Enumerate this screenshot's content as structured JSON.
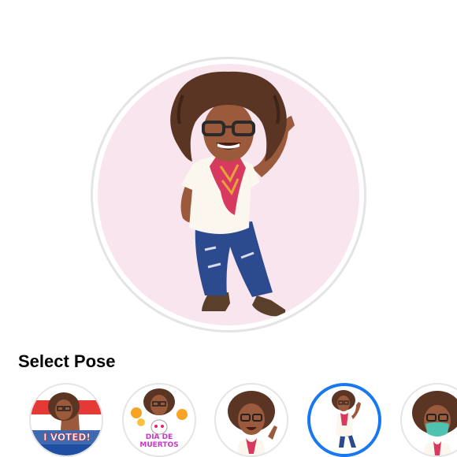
{
  "section": {
    "title": "Select Pose"
  },
  "preview": {
    "background_color": "#f9e5ee",
    "ring_color": "#e4e4e6"
  },
  "poses": [
    {
      "name": "I Voted",
      "sticker_text": "I VOTED!",
      "selected": false
    },
    {
      "name": "Dia de Muertos",
      "sticker_text": "DIA DE MUERTOS",
      "selected": false
    },
    {
      "name": "Waving",
      "selected": false
    },
    {
      "name": "Standing wave",
      "selected": true
    },
    {
      "name": "Face mask",
      "selected": false
    }
  ],
  "colors": {
    "accent": "#1877f2",
    "hair": "#5a3524",
    "skin": "#9b5a3c",
    "shirt": "#fbf6ee",
    "scarf": "#d8395f",
    "jeans": "#2c4a8e",
    "boots": "#5a3f2b"
  }
}
